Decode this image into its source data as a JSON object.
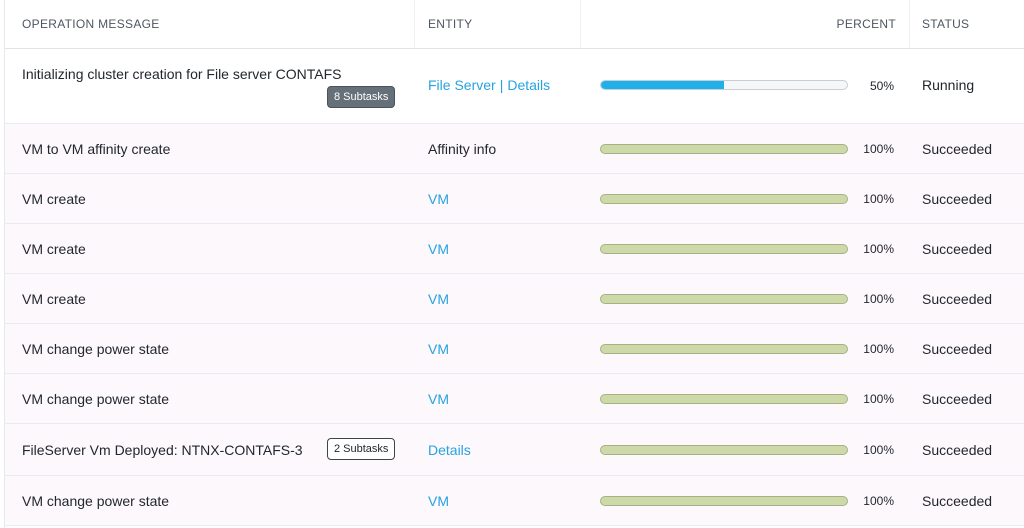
{
  "columns": {
    "operation_message": "OPERATION MESSAGE",
    "entity": "ENTITY",
    "percent": "PERCENT",
    "status": "STATUS"
  },
  "rows": [
    {
      "message": "Initializing cluster creation for File server CONTAFS",
      "subtasks_badge": "8 Subtasks",
      "entity_link_1": "File Server",
      "entity_sep": "|",
      "entity_link_2": "Details",
      "progress": 0.5,
      "percent": "50%",
      "status": "Running"
    },
    {
      "message": "VM to VM affinity create",
      "entity": "Affinity info",
      "entity_is_link": false,
      "progress": 1.0,
      "percent": "100%",
      "status": "Succeeded"
    },
    {
      "message": "VM create",
      "entity": "VM",
      "entity_is_link": true,
      "progress": 1.0,
      "percent": "100%",
      "status": "Succeeded"
    },
    {
      "message": "VM create",
      "entity": "VM",
      "entity_is_link": true,
      "progress": 1.0,
      "percent": "100%",
      "status": "Succeeded"
    },
    {
      "message": "VM create",
      "entity": "VM",
      "entity_is_link": true,
      "progress": 1.0,
      "percent": "100%",
      "status": "Succeeded"
    },
    {
      "message": "VM change power state",
      "entity": "VM",
      "entity_is_link": true,
      "progress": 1.0,
      "percent": "100%",
      "status": "Succeeded"
    },
    {
      "message": "VM change power state",
      "entity": "VM",
      "entity_is_link": true,
      "progress": 1.0,
      "percent": "100%",
      "status": "Succeeded"
    },
    {
      "message": "FileServer Vm Deployed: NTNX-CONTAFS-3",
      "subtasks_badge": "2 Subtasks",
      "entity": "Details",
      "entity_is_link": true,
      "progress": 1.0,
      "percent": "100%",
      "status": "Succeeded"
    },
    {
      "message": "VM change power state",
      "entity": "VM",
      "entity_is_link": true,
      "progress": 1.0,
      "percent": "100%",
      "status": "Succeeded"
    }
  ],
  "colors": {
    "link": "#27a3de",
    "progress_running": "#1fb0ea",
    "progress_done": "#cdd9a8"
  }
}
